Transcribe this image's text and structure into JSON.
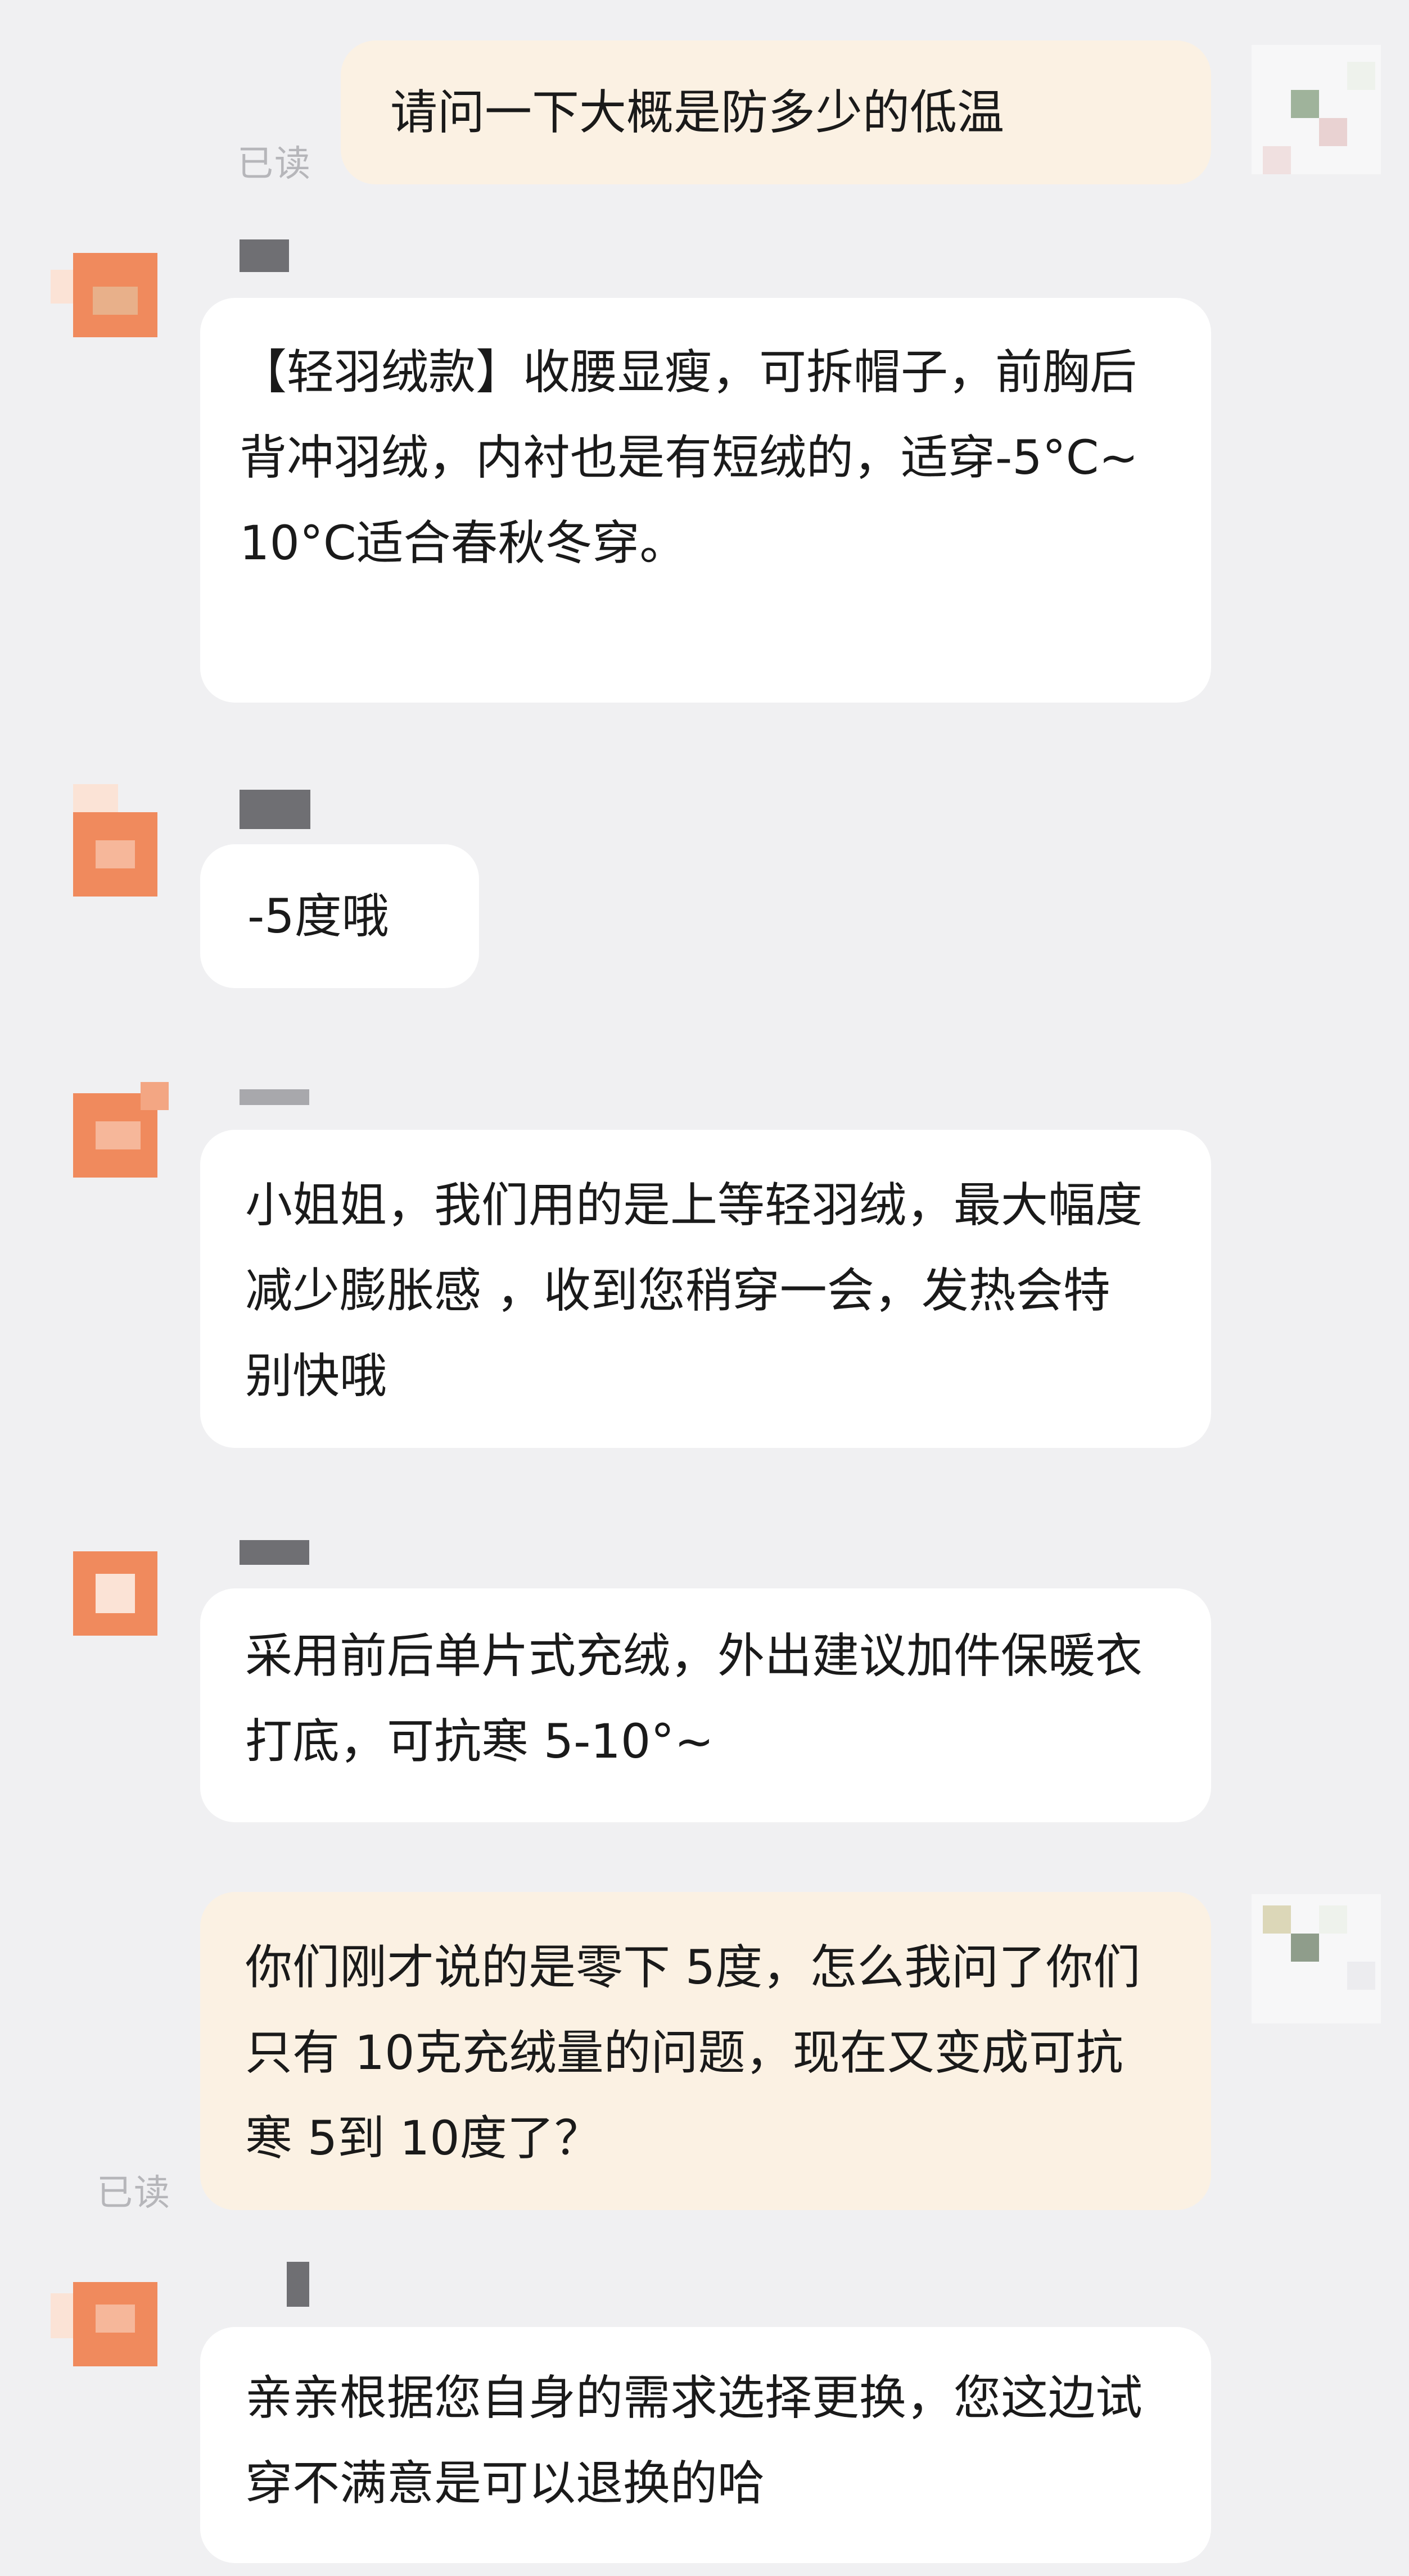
{
  "colors": {
    "background": "#f0f0f2",
    "incoming_bubble": "#ffffff",
    "outgoing_bubble": "#fbf1e3",
    "avatar_accent": "#f08a5d",
    "read_text": "#b6b6ba"
  },
  "messages": [
    {
      "side": "me",
      "text": "请问一下大概是防多少的低温",
      "status": "已读"
    },
    {
      "side": "them",
      "text": "【轻羽绒款】收腰显瘦，可拆帽子，前胸后背冲羽绒，内衬也是有短绒的，适穿-5°C~10°C适合春秋冬穿。"
    },
    {
      "side": "them",
      "text": "-5度哦"
    },
    {
      "side": "them",
      "text": "小姐姐，我们用的是上等轻羽绒，最大幅度减少膨胀感 ，收到您稍穿一会，发热会特别快哦"
    },
    {
      "side": "them",
      "text": "采用前后单片式充绒，外出建议加件保暖衣打底，可抗寒 5-10°~"
    },
    {
      "side": "me",
      "text": "你们刚才说的是零下 5度，怎么我问了你们只有 10克充绒量的问题，现在又变成可抗寒 5到 10度了？",
      "status": "已读"
    },
    {
      "side": "them",
      "text": "亲亲根据您自身的需求选择更换，您这边试穿不满意是可以退换的哈"
    }
  ]
}
